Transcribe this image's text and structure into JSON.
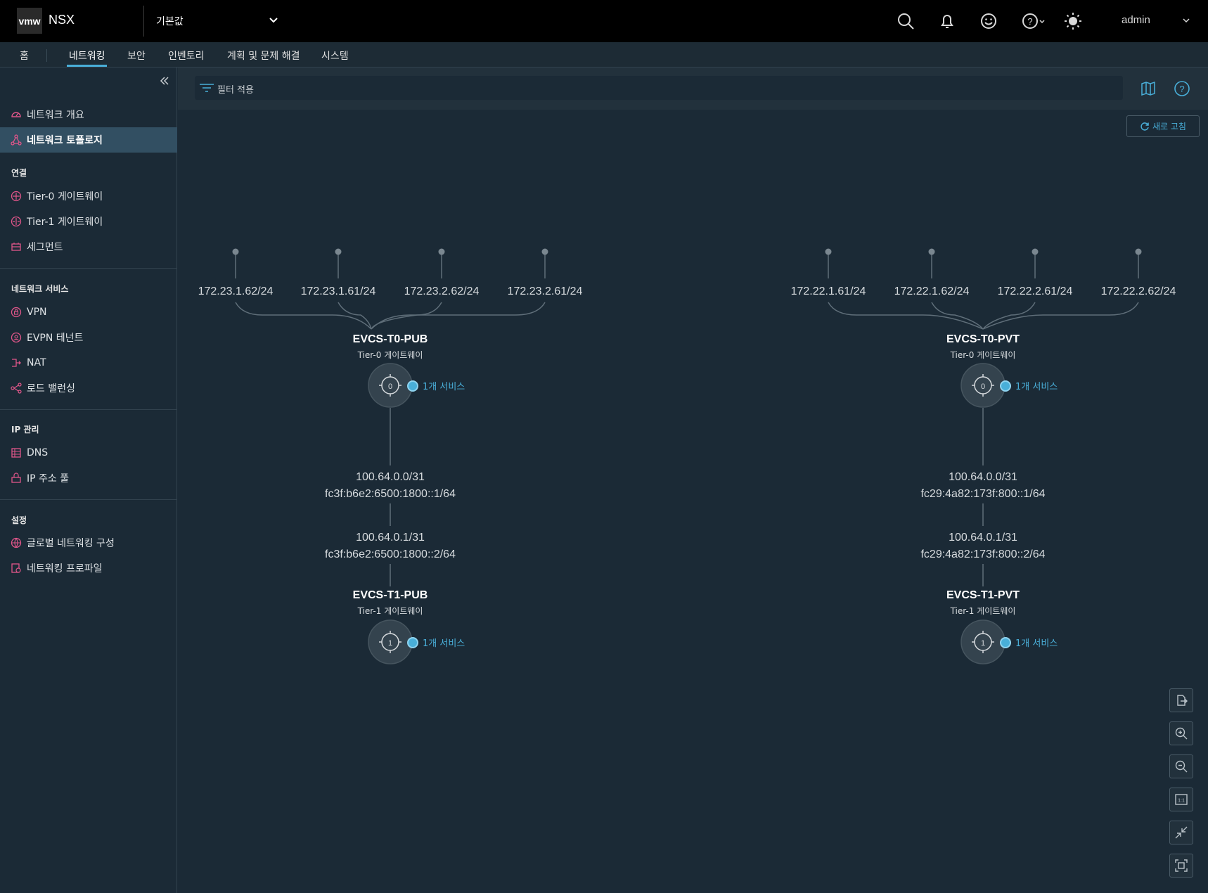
{
  "header": {
    "logo": "vmw",
    "product": "NSX",
    "project": "기본값",
    "user": "admin",
    "icons": [
      "search-icon",
      "bell-icon",
      "feedback-smiley-icon",
      "help-icon",
      "theme-sun-icon"
    ]
  },
  "tabs": [
    {
      "label": "홈",
      "active": false
    },
    {
      "label": "네트워킹",
      "active": true
    },
    {
      "label": "보안",
      "active": false
    },
    {
      "label": "인벤토리",
      "active": false
    },
    {
      "label": "계획 및 문제 해결",
      "active": false
    },
    {
      "label": "시스템",
      "active": false
    }
  ],
  "sidebar": {
    "top_items": [
      {
        "label": "네트워크 개요",
        "active": false
      },
      {
        "label": "네트워크 토폴로지",
        "active": true
      }
    ],
    "sections": [
      {
        "title": "연결",
        "items": [
          {
            "label": "Tier-0 게이트웨이"
          },
          {
            "label": "Tier-1 게이트웨이"
          },
          {
            "label": "세그먼트"
          }
        ]
      },
      {
        "title": "네트워크 서비스",
        "items": [
          {
            "label": "VPN"
          },
          {
            "label": "EVPN 테넌트"
          },
          {
            "label": "NAT"
          },
          {
            "label": "로드 밸런싱"
          }
        ]
      },
      {
        "title": "IP 관리",
        "items": [
          {
            "label": "DNS"
          },
          {
            "label": "IP 주소 풀"
          }
        ]
      },
      {
        "title": "설정",
        "items": [
          {
            "label": "글로벌 네트워킹 구성"
          },
          {
            "label": "네트워킹 프로파일"
          }
        ]
      }
    ]
  },
  "main": {
    "filter_placeholder": "필터 적용",
    "refresh_label": "새로 고침"
  },
  "topology": {
    "left": {
      "uplinks": [
        "172.23.1.62/24",
        "172.23.1.61/24",
        "172.23.2.62/24",
        "172.23.2.61/24"
      ],
      "t0": {
        "name": "EVCS-T0-PUB",
        "type": "Tier-0 게이트웨이",
        "services": "1개 서비스",
        "badge": "0"
      },
      "link_t0": [
        "100.64.0.0/31",
        "fc3f:b6e2:6500:1800::1/64"
      ],
      "link_t1": [
        "100.64.0.1/31",
        "fc3f:b6e2:6500:1800::2/64"
      ],
      "t1": {
        "name": "EVCS-T1-PUB",
        "type": "Tier-1 게이트웨이",
        "services": "1개 서비스",
        "badge": "1"
      }
    },
    "right": {
      "uplinks": [
        "172.22.1.61/24",
        "172.22.1.62/24",
        "172.22.2.61/24",
        "172.22.2.62/24"
      ],
      "t0": {
        "name": "EVCS-T0-PVT",
        "type": "Tier-0 게이트웨이",
        "services": "1개 서비스",
        "badge": "0"
      },
      "link_t0": [
        "100.64.0.0/31",
        "fc29:4a82:173f:800::1/64"
      ],
      "link_t1": [
        "100.64.0.1/31",
        "fc29:4a82:173f:800::2/64"
      ],
      "t1": {
        "name": "EVCS-T1-PVT",
        "type": "Tier-1 게이트웨이",
        "services": "1개 서비스",
        "badge": "1"
      }
    }
  },
  "controls": [
    {
      "name": "export-icon"
    },
    {
      "name": "zoom-in-icon"
    },
    {
      "name": "zoom-out-icon"
    },
    {
      "name": "actual-size-icon",
      "text": "1:1"
    },
    {
      "name": "collapse-view-icon"
    },
    {
      "name": "fit-to-screen-icon"
    }
  ],
  "colors": {
    "accent": "#49afd9",
    "nav_active_bg": "#324f62",
    "background": "#1b2a36",
    "header_bg": "#000000"
  }
}
